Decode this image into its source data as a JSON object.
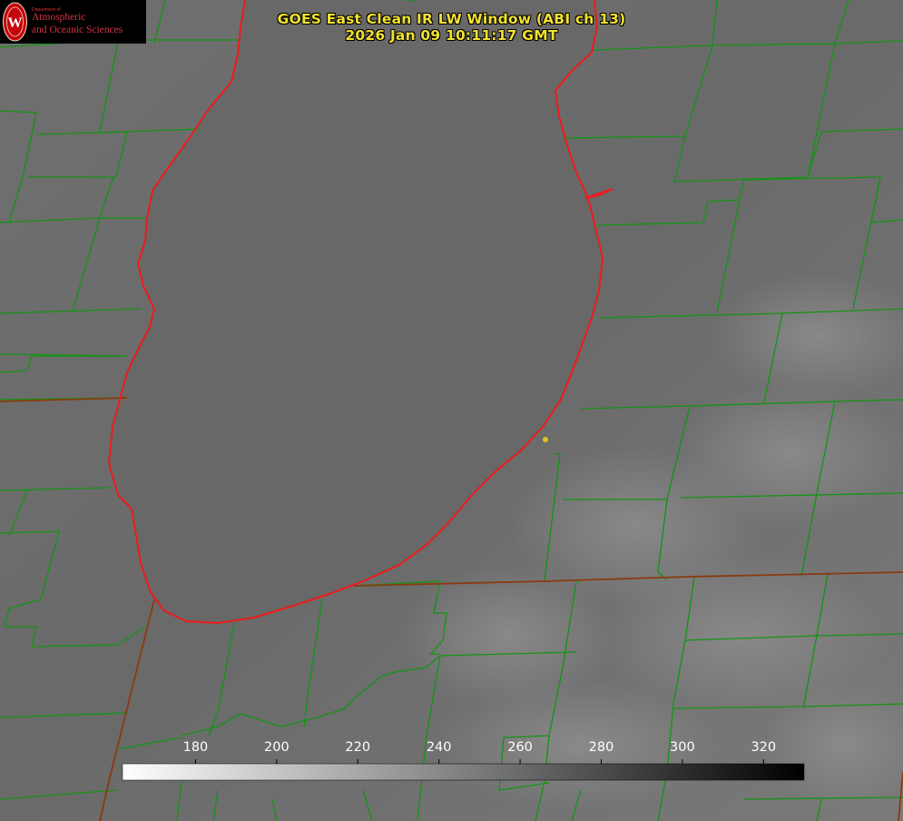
{
  "title_line1": "GOES East Clean IR LW Window (ABI ch 13)",
  "title_line2": "2026 Jan 09 10:11:17 GMT",
  "logo": {
    "dept_label": "Department of",
    "line1": "Atmospheric",
    "line2": "and Oceanic Sciences",
    "seal_icon": "uw-crest-icon",
    "accent_color": "#c5050c"
  },
  "colorbar": {
    "ticks": [
      "180",
      "200",
      "220",
      "240",
      "260",
      "280",
      "300",
      "320"
    ],
    "tick_values": [
      180,
      200,
      220,
      240,
      260,
      280,
      300,
      320
    ],
    "range": [
      162,
      330
    ],
    "gradient": "white-to-black"
  },
  "colors": {
    "title_text": "#f2e12f",
    "county_lines": "#139413",
    "coastline": "#ee1b1b",
    "state_line": "#8a3a10",
    "marker": "#e0c21c"
  }
}
